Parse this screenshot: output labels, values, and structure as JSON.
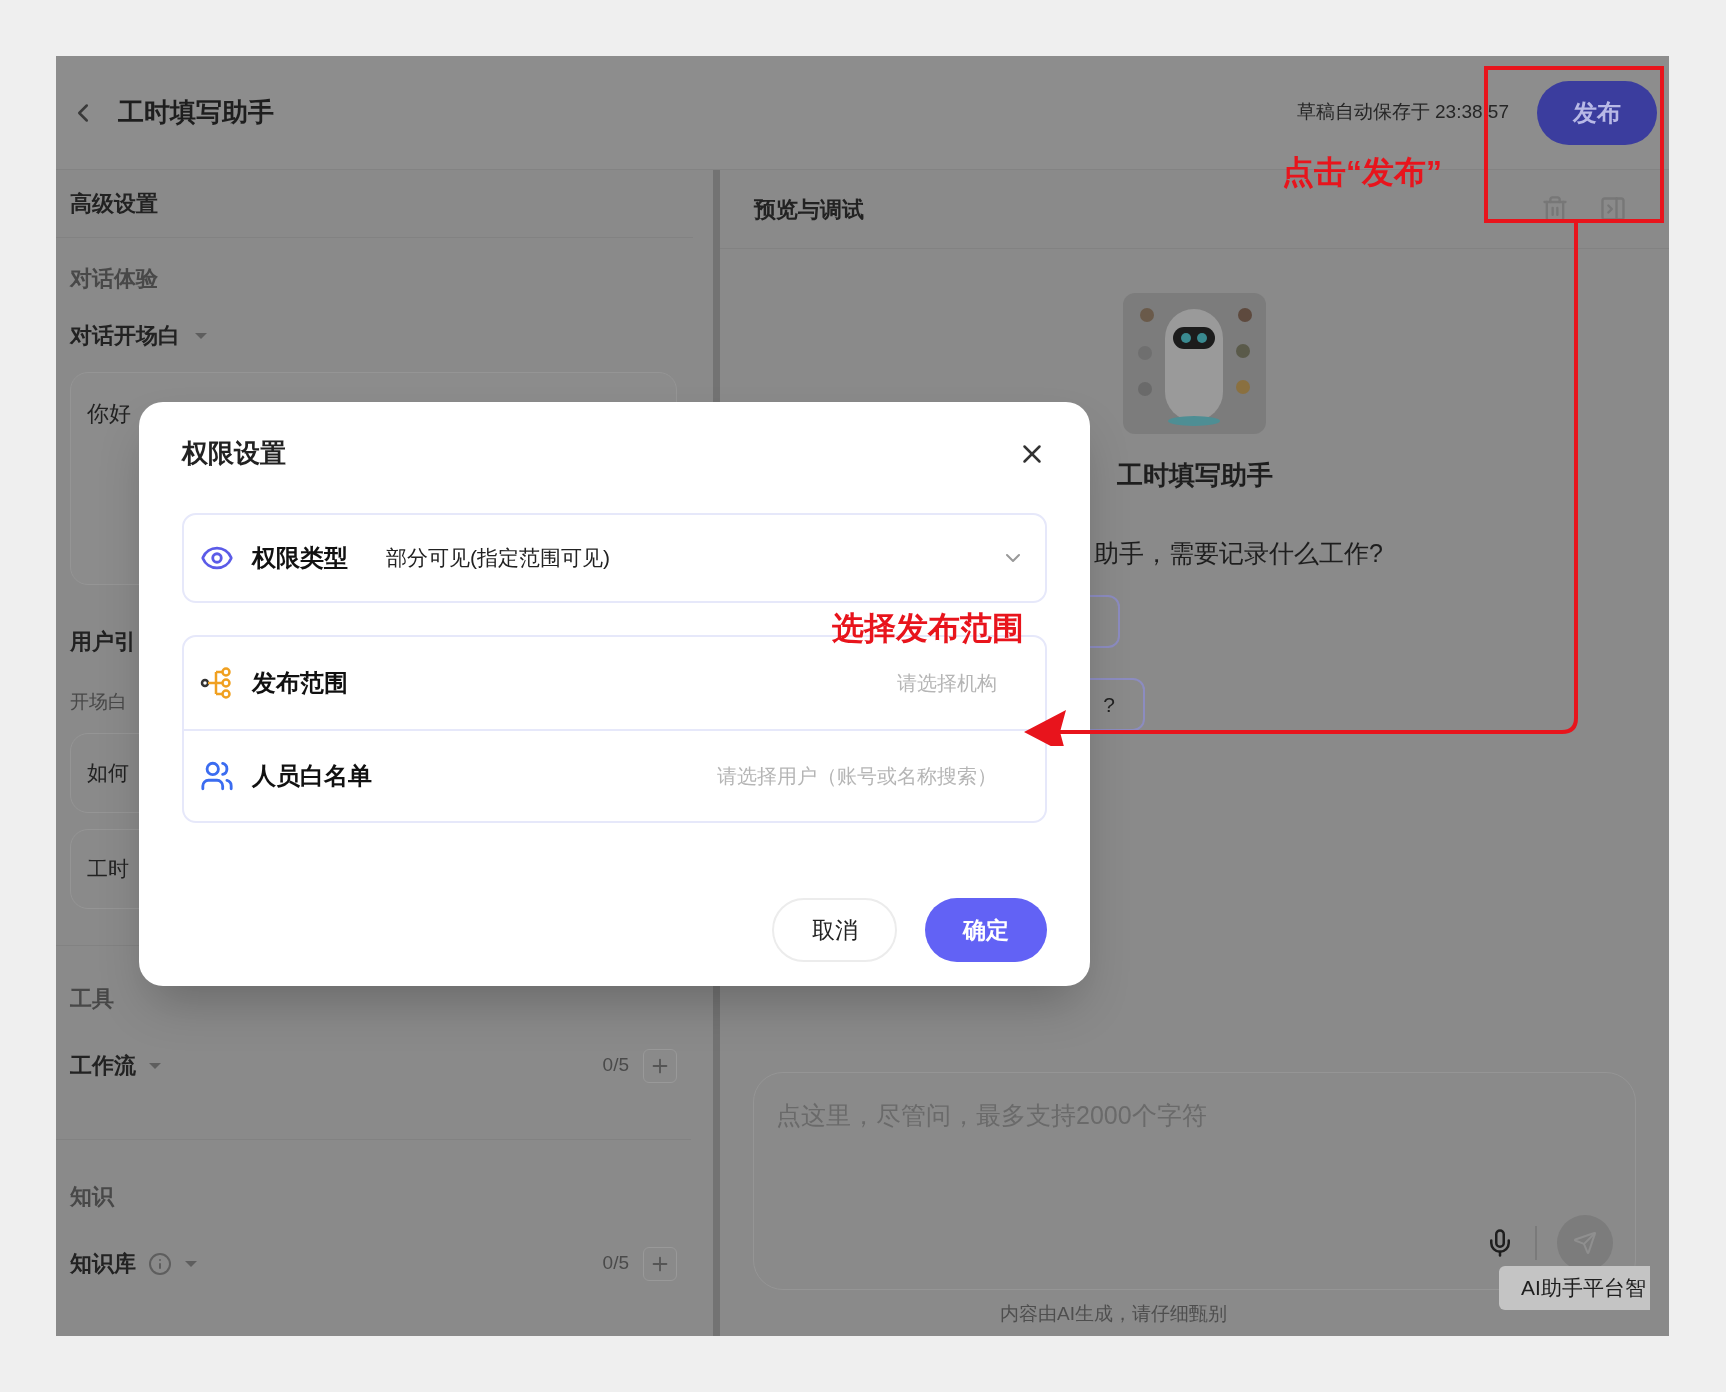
{
  "header": {
    "title": "工时填写助手",
    "autosave": "草稿自动保存于 23:38:57",
    "publish": "发布"
  },
  "settings": {
    "title": "高级设置",
    "conversation": {
      "heading": "对话体验",
      "opener_label": "对话开场白",
      "opener_text": "你好"
    },
    "guide": {
      "heading": "用户引",
      "sub": "开场白",
      "questions": [
        "如何",
        "工时"
      ]
    },
    "tools": {
      "heading": "工具",
      "items": [
        {
          "label": "工作流",
          "count": "0/5",
          "info": false
        }
      ]
    },
    "knowledge": {
      "heading": "知识",
      "items": [
        {
          "label": "知识库",
          "count": "0/5",
          "info": true
        }
      ]
    }
  },
  "preview": {
    "title": "预览与调试",
    "bot_name": "工时填写助手",
    "greeting": "助手，需要记录什么工作?",
    "suggestion_chips": [
      {
        "kind": "blank"
      },
      {
        "kind": "text",
        "text": "?"
      }
    ],
    "input": {
      "placeholder": "点这里，尽管问，最多支持2000个字符"
    },
    "disclaimer": "内容由AI生成，请仔细甄别",
    "tooltip": "AI助手平台智"
  },
  "dialog": {
    "title": "权限设置",
    "permission_type": {
      "label": "权限类型",
      "value": "部分可见(指定范围可见)"
    },
    "fields": [
      {
        "kind": "org",
        "label": "发布范围",
        "placeholder": "请选择机构"
      },
      {
        "kind": "users",
        "label": "人员白名单",
        "placeholder": "请选择用户（账号或名称搜索）"
      }
    ],
    "buttons": [
      {
        "kind": "secondary",
        "label": "取消"
      },
      {
        "kind": "primary",
        "label": "确定"
      }
    ]
  },
  "annotations": [
    {
      "text": "点击“发布”"
    },
    {
      "text": "选择发布范围"
    }
  ]
}
